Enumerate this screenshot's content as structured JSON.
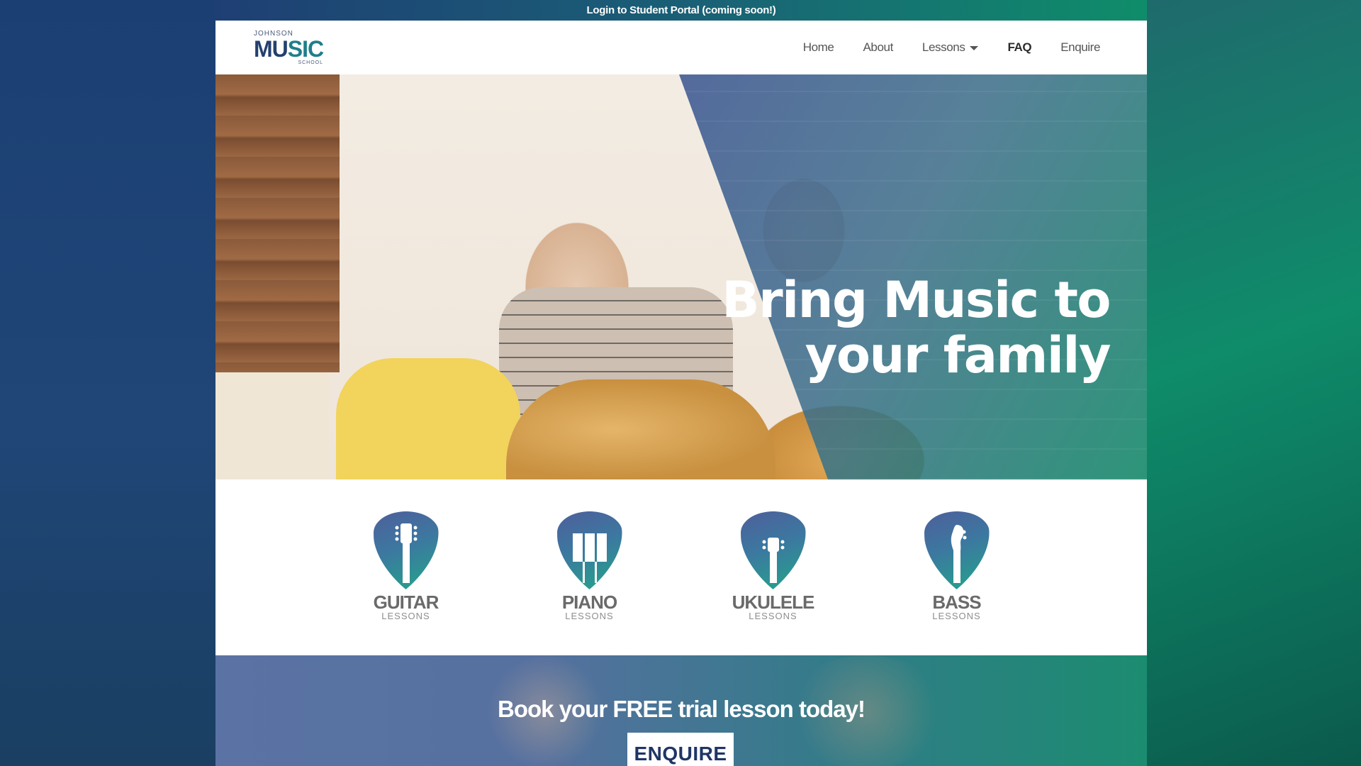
{
  "topbar": {
    "text": "Login to Student Portal (coming soon!)"
  },
  "logo": {
    "top": "JOHNSON",
    "main_a": "MU",
    "main_b": "S",
    "main_c": "IC",
    "sub": "SCHOOL"
  },
  "nav": {
    "items": [
      {
        "label": "Home"
      },
      {
        "label": "About"
      },
      {
        "label": "Lessons"
      },
      {
        "label": "FAQ"
      },
      {
        "label": "Enquire"
      }
    ]
  },
  "hero": {
    "title_line1": "Bring Music to",
    "title_line2": "your family"
  },
  "lessons": [
    {
      "title": "GUITAR",
      "sub": "LESSONS",
      "icon": "guitar-icon"
    },
    {
      "title": "PIANO",
      "sub": "LESSONS",
      "icon": "piano-icon"
    },
    {
      "title": "UKULELE",
      "sub": "LESSONS",
      "icon": "ukulele-icon"
    },
    {
      "title": "BASS",
      "sub": "LESSONS",
      "icon": "bass-icon"
    }
  ],
  "cta": {
    "heading": "Book your FREE trial lesson today!",
    "button": "ENQUIRE"
  },
  "colors": {
    "brand_blue": "#24406f",
    "brand_teal": "#0f8d6a",
    "overlay_blue": "#465f96"
  }
}
